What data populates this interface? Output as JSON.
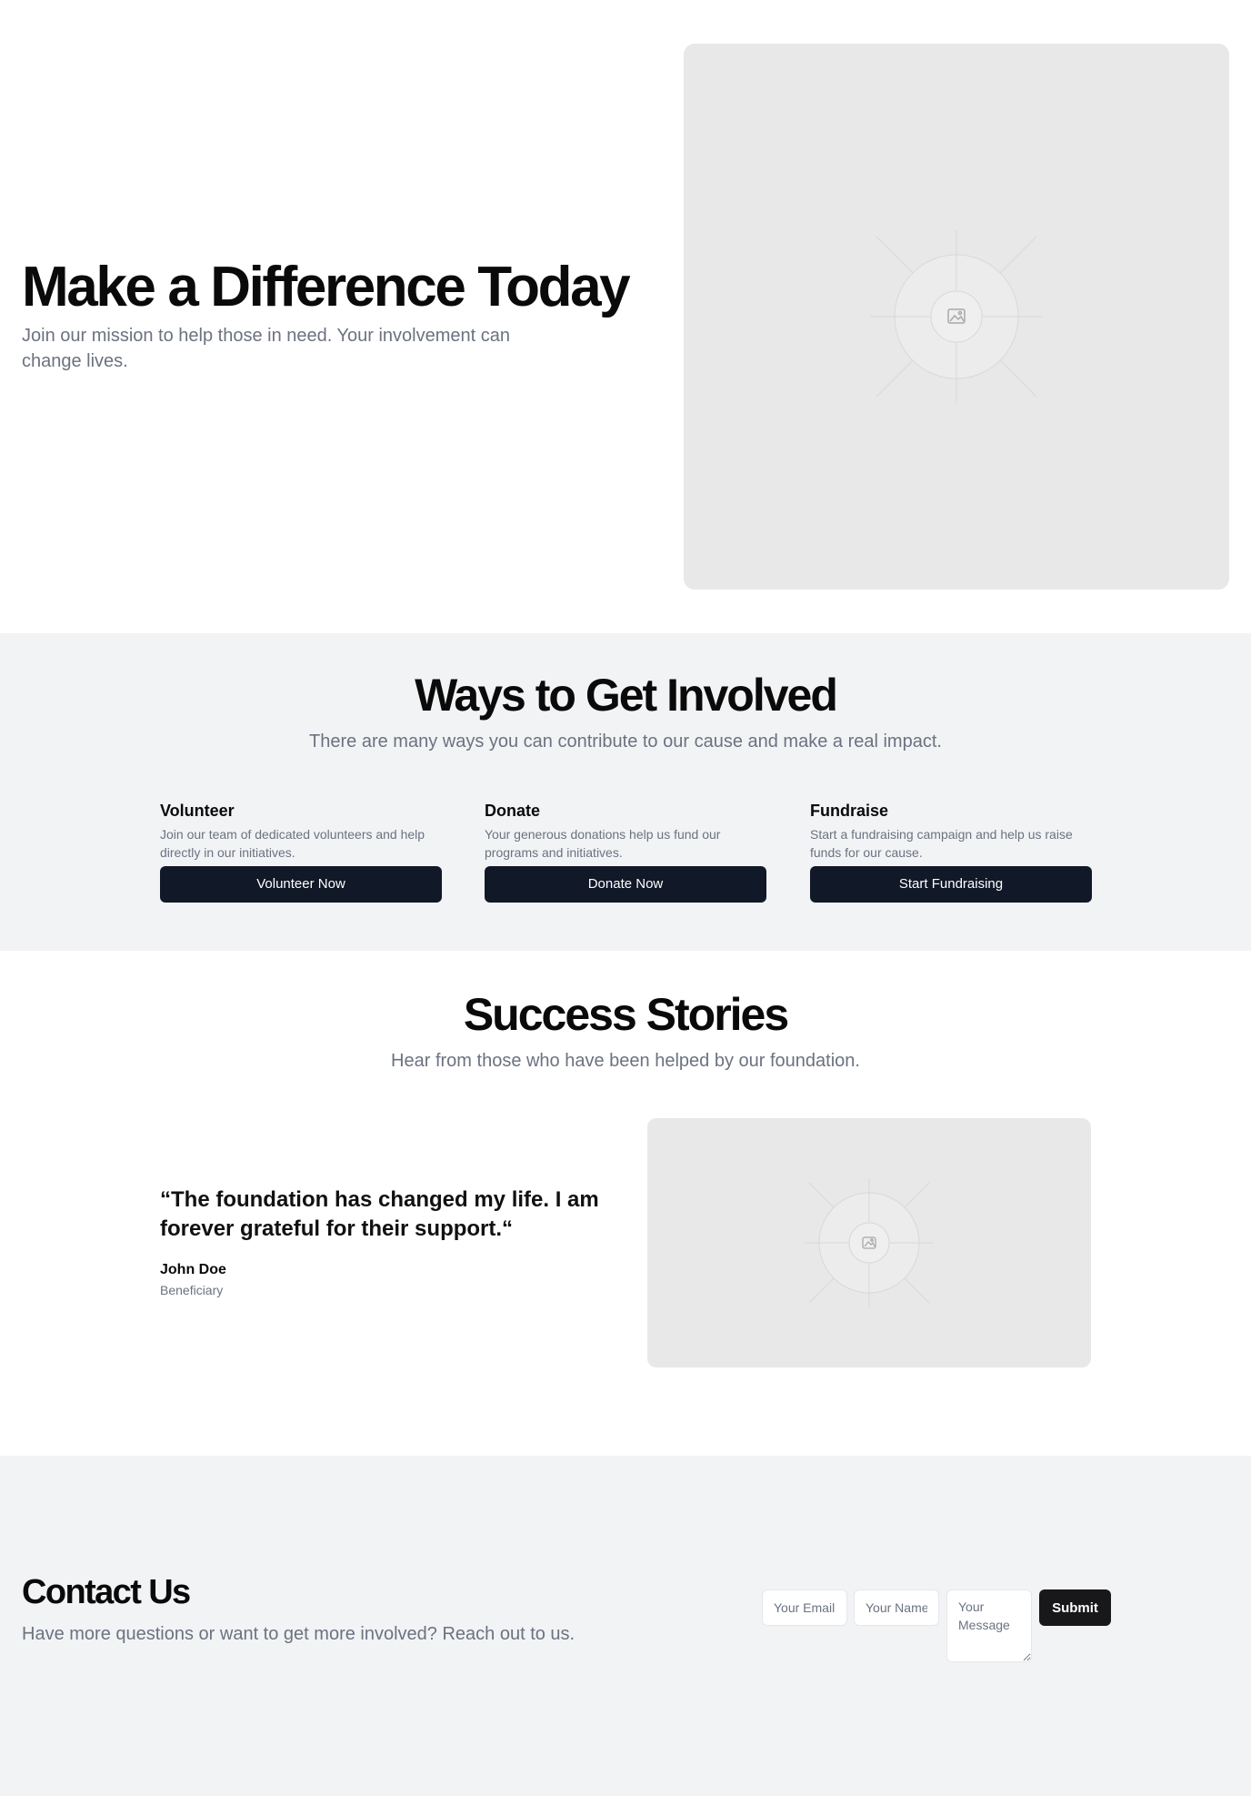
{
  "hero": {
    "title": "Make a Difference Today",
    "subtitle": "Join our mission to help those in need. Your involvement can change lives.",
    "image_icon": "image-placeholder-icon"
  },
  "ways": {
    "title": "Ways to Get Involved",
    "subtitle": "There are many ways you can contribute to our cause and make a real impact.",
    "cards": [
      {
        "title": "Volunteer",
        "description": "Join our team of dedicated volunteers and help directly in our initiatives.",
        "button": "Volunteer Now"
      },
      {
        "title": "Donate",
        "description": "Your generous donations help us fund our programs and initiatives.",
        "button": "Donate Now"
      },
      {
        "title": "Fundraise",
        "description": "Start a fundraising campaign and help us raise funds for our cause.",
        "button": "Start Fundraising"
      }
    ]
  },
  "stories": {
    "title": "Success Stories",
    "subtitle": "Hear from those who have been helped by our foundation.",
    "quote": "“The foundation has changed my life. I am forever grateful for their support.“",
    "author": "John Doe",
    "role": "Beneficiary",
    "image_icon": "image-placeholder-icon"
  },
  "contact": {
    "title": "Contact Us",
    "subtitle": "Have more questions or want to get more involved? Reach out to us.",
    "email_placeholder": "Your Email",
    "name_placeholder": "Your Name",
    "message_placeholder": "Your Message",
    "submit_label": "Submit"
  },
  "colors": {
    "primary_button": "#111827",
    "submit_button": "#18181b",
    "muted_text": "#6b7280",
    "section_background": "#f2f3f5",
    "placeholder_background": "#e8e8e8"
  }
}
